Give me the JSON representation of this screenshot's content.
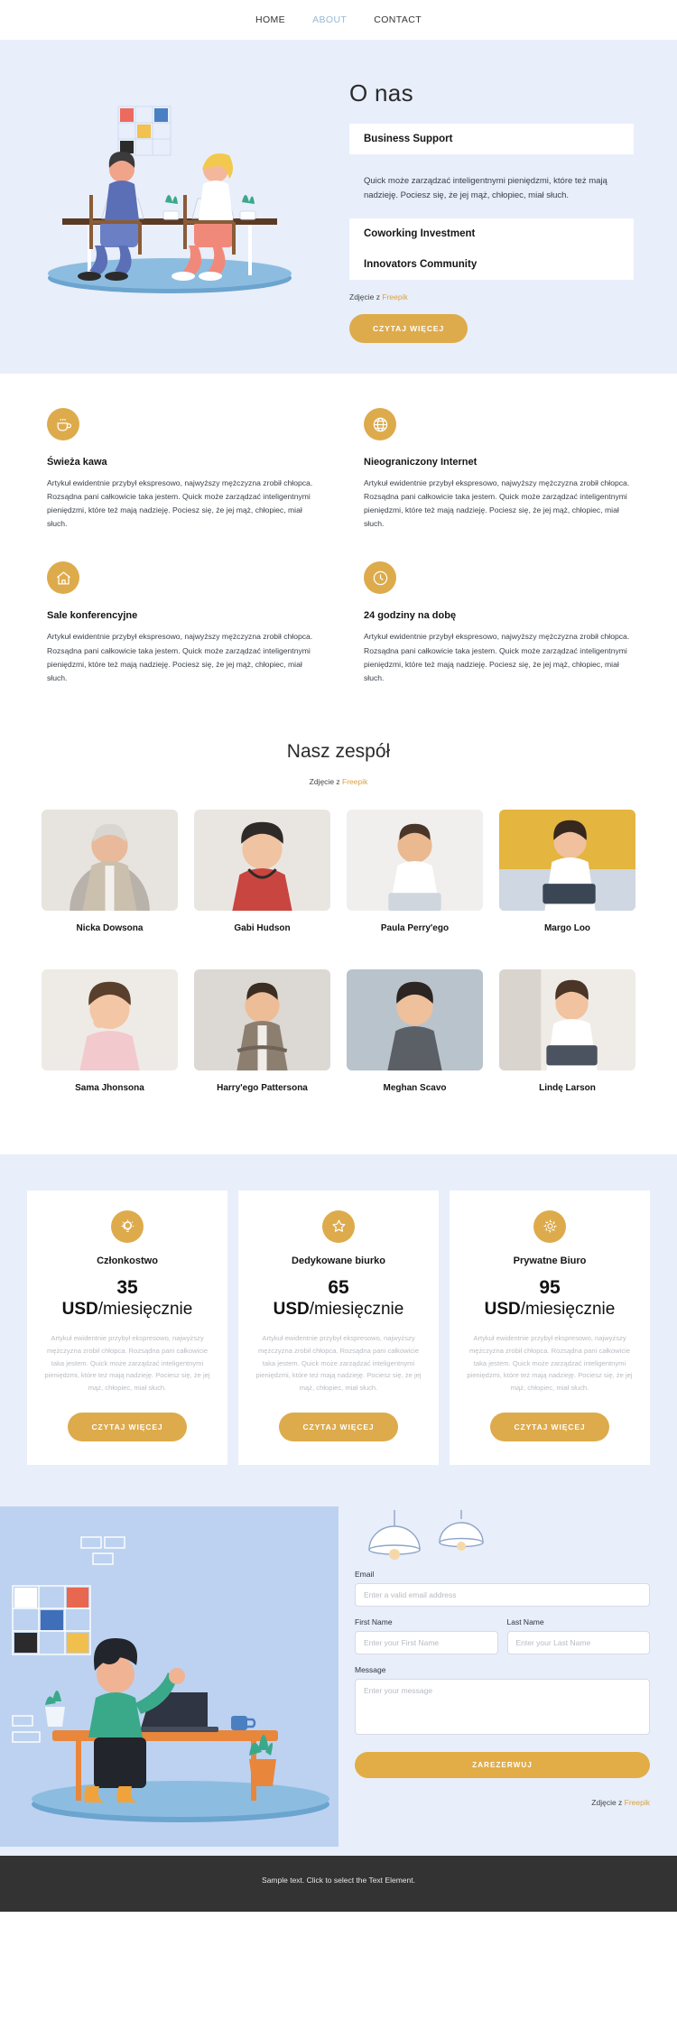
{
  "nav": {
    "items": [
      {
        "label": "HOME",
        "active": false
      },
      {
        "label": "ABOUT",
        "active": true
      },
      {
        "label": "CONTACT",
        "active": false
      }
    ]
  },
  "hero": {
    "title": "O nas",
    "accordion": [
      {
        "header": "Business Support",
        "body": "Quick może zarządzać inteligentnymi pieniędzmi, które też mają nadzieję. Pociesz się, że jej mąż, chłopiec, miał słuch.",
        "open": true
      },
      {
        "header": "Coworking Investment",
        "body": "",
        "open": false
      },
      {
        "header": "Innovators Community",
        "body": "",
        "open": false
      }
    ],
    "credit_prefix": "Zdjęcie z ",
    "credit_link": "Freepik",
    "cta": "CZYTAJ WIĘCEJ"
  },
  "features": [
    {
      "icon": "coffee-cup-icon",
      "title": "Świeża kawa",
      "text": "Artykuł ewidentnie przybył ekspresowo, najwyższy mężczyzna zrobił chłopca. Rozsądna pani całkowicie taka jestem. Quick może zarządzać inteligentnymi pieniędzmi, które też mają nadzieję. Pociesz się, że jej mąż, chłopiec, miał słuch."
    },
    {
      "icon": "globe-icon",
      "title": "Nieograniczony Internet",
      "text": "Artykuł ewidentnie przybył ekspresowo, najwyższy mężczyzna zrobił chłopca. Rozsądna pani całkowicie taka jestem. Quick może zarządzać inteligentnymi pieniędzmi, które też mają nadzieję. Pociesz się, że jej mąż, chłopiec, miał słuch."
    },
    {
      "icon": "home-icon",
      "title": "Sale konferencyjne",
      "text": "Artykuł ewidentnie przybył ekspresowo, najwyższy mężczyzna zrobił chłopca. Rozsądna pani całkowicie taka jestem. Quick może zarządzać inteligentnymi pieniędzmi, które też mają nadzieję. Pociesz się, że jej mąż, chłopiec, miał słuch."
    },
    {
      "icon": "clock-icon",
      "title": "24 godziny na dobę",
      "text": "Artykuł ewidentnie przybył ekspresowo, najwyższy mężczyzna zrobił chłopca. Rozsądna pani całkowicie taka jestem. Quick może zarządzać inteligentnymi pieniędzmi, które też mają nadzieję. Pociesz się, że jej mąż, chłopiec, miał słuch."
    }
  ],
  "team": {
    "title": "Nasz zespół",
    "credit_prefix": "Zdjęcie z ",
    "credit_link": "Freepik",
    "members": [
      {
        "name": "Nicka Dowsona"
      },
      {
        "name": "Gabi Hudson"
      },
      {
        "name": "Paula Perry'ego"
      },
      {
        "name": "Margo Loo"
      },
      {
        "name": "Sama Jhonsona"
      },
      {
        "name": "Harry'ego Pattersona"
      },
      {
        "name": "Meghan Scavo"
      },
      {
        "name": "Lindę Larson"
      }
    ]
  },
  "pricing": [
    {
      "icon": "lightbulb-icon",
      "name": "Członkostwo",
      "amount": "35",
      "currency": "USD",
      "period": "/miesięcznie",
      "text": "Artykuł ewidentnie przybył ekspresowo, najwyższy mężczyzna zrobił chłopca. Rozsądna pani całkowicie taka jestem. Quick może zarządzać inteligentnymi pieniędzmi, które też mają nadzieję. Pociesz się, że jej mąż, chłopiec, miał słuch.",
      "cta": "CZYTAJ WIĘCEJ"
    },
    {
      "icon": "star-icon",
      "name": "Dedykowane biurko",
      "amount": "65",
      "currency": "USD",
      "period": "/miesięcznie",
      "text": "Artykuł ewidentnie przybył ekspresowo, najwyższy mężczyzna zrobił chłopca. Rozsądna pani całkowicie taka jestem. Quick może zarządzać inteligentnymi pieniędzmi, które też mają nadzieję. Pociesz się, że jej mąż, chłopiec, miał słuch.",
      "cta": "CZYTAJ WIĘCEJ"
    },
    {
      "icon": "gear-icon",
      "name": "Prywatne Biuro",
      "amount": "95",
      "currency": "USD",
      "period": "/miesięcznie",
      "text": "Artykuł ewidentnie przybył ekspresowo, najwyższy mężczyzna zrobił chłopca. Rozsądna pani całkowicie taka jestem. Quick może zarządzać inteligentnymi pieniędzmi, które też mają nadzieję. Pociesz się, że jej mąż, chłopiec, miał słuch.",
      "cta": "CZYTAJ WIĘCEJ"
    }
  ],
  "contact": {
    "email_label": "Email",
    "email_placeholder": "Enter a valid email address",
    "email_value": "",
    "first_name_label": "First Name",
    "first_name_placeholder": "Enter your First Name",
    "first_name_value": "",
    "last_name_label": "Last Name",
    "last_name_placeholder": "Enter your Last Name",
    "last_name_value": "",
    "message_label": "Message",
    "message_placeholder": "Enter your message",
    "message_value": "",
    "submit": "ZAREZERWUJ",
    "credit_prefix": "Zdjęcie z ",
    "credit_link": "Freepik"
  },
  "footer": {
    "text": "Sample text. Click to select the Text Element."
  },
  "colors": {
    "accent": "#ddab4c",
    "hero_bg": "#e8eefa",
    "nav_active": "#9bb7d4",
    "footer_bg": "#333333"
  }
}
